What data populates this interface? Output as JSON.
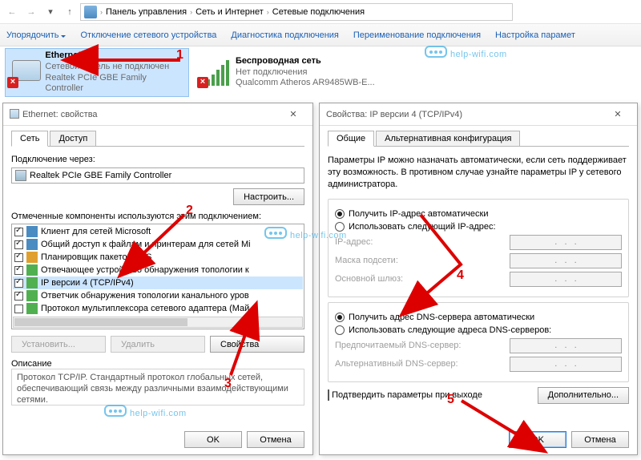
{
  "breadcrumb": {
    "p1": "Панель управления",
    "p2": "Сеть и Интернет",
    "p3": "Сетевые подключения"
  },
  "toolbar": {
    "org": "Упорядочить",
    "dis": "Отключение сетевого устройства",
    "diag": "Диагностика подключения",
    "ren": "Переименование подключения",
    "set": "Настройка парамет"
  },
  "adapters": {
    "eth": {
      "name": "Ethernet",
      "status": "Сетевой кабель не подключен",
      "dev": "Realtek PCIe GBE Family Controller"
    },
    "wifi": {
      "name": "Беспроводная сеть",
      "status": "Нет подключения",
      "dev": "Qualcomm Atheros AR9485WB-E..."
    }
  },
  "dlg1": {
    "title": "Ethernet: свойства",
    "tab1": "Сеть",
    "tab2": "Доступ",
    "conn_via": "Подключение через:",
    "adapter": "Realtek PCIe GBE Family Controller",
    "config": "Настроить...",
    "comp_lbl": "Отмеченные компоненты используются этим подключением:",
    "items": [
      "Клиент для сетей Microsoft",
      "Общий доступ к файлам и принтерам для сетей Mi",
      "Планировщик пакетов QoS",
      "Отвечающее устройство обнаружения топологии к",
      "IP версии 4 (TCP/IPv4)",
      "Ответчик обнаружения топологии канального уров",
      "Протокол мультиплексора сетевого адаптера (Май"
    ],
    "install": "Установить...",
    "remove": "Удалить",
    "props": "Свойства",
    "desc_t": "Описание",
    "desc": "Протокол TCP/IP. Стандартный протокол глобальных сетей, обеспечивающий связь между различными взаимодействующими сетями.",
    "ok": "OK",
    "cancel": "Отмена"
  },
  "dlg2": {
    "title": "Свойства: IP версии 4 (TCP/IPv4)",
    "tab1": "Общие",
    "tab2": "Альтернативная конфигурация",
    "intro": "Параметры IP можно назначать автоматически, если сеть поддерживает эту возможность. В противном случае узнайте параметры IP у сетевого администратора.",
    "r1": "Получить IP-адрес автоматически",
    "r2": "Использовать следующий IP-адрес:",
    "ip": "IP-адрес:",
    "mask": "Маска подсети:",
    "gw": "Основной шлюз:",
    "r3": "Получить адрес DNS-сервера автоматически",
    "r4": "Использовать следующие адреса DNS-серверов:",
    "d1": "Предпочитаемый DNS-сервер:",
    "d2": "Альтернативный DNS-сервер:",
    "confirm": "Подтвердить параметры при выходе",
    "adv": "Дополнительно...",
    "ok": "OK",
    "cancel": "Отмена"
  },
  "watermark": "help-wifi.com"
}
